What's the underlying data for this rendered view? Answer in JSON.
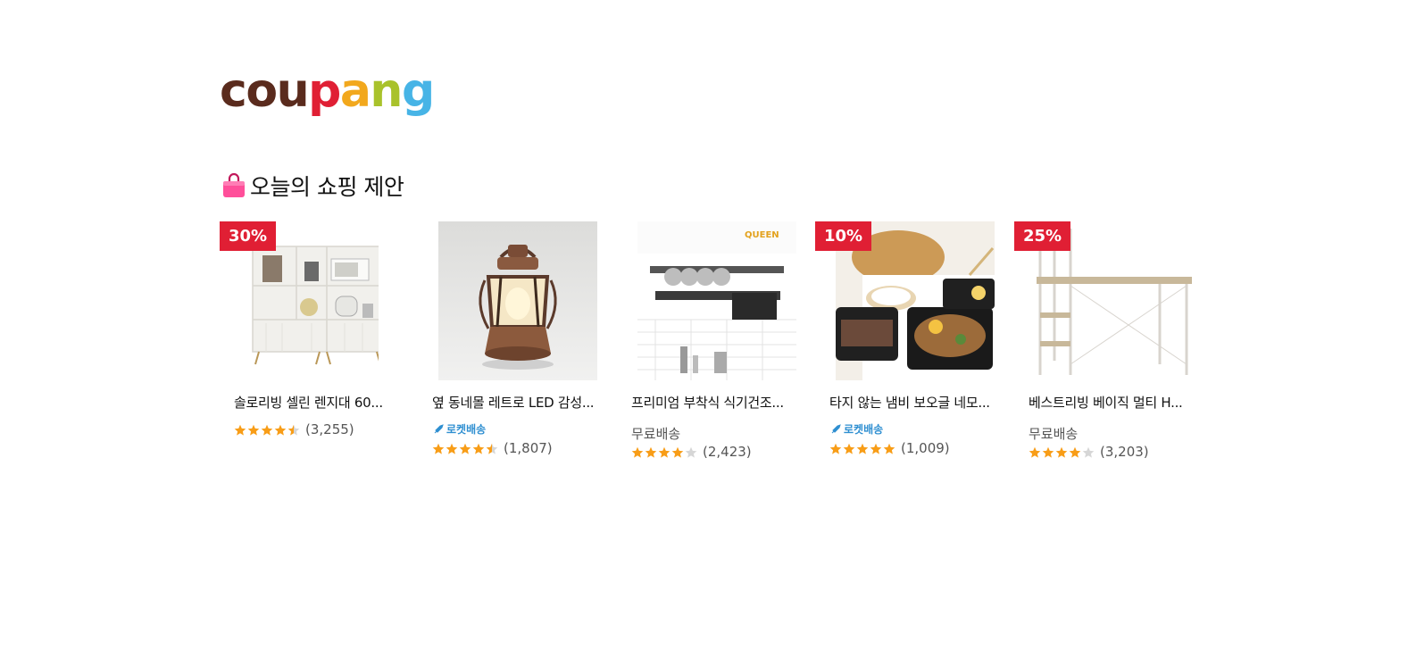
{
  "logo": {
    "letters": [
      {
        "char": "c",
        "color": "#5a2b1d"
      },
      {
        "char": "o",
        "color": "#5a2b1d"
      },
      {
        "char": "u",
        "color": "#5a2b1d"
      },
      {
        "char": "p",
        "color": "#e01f34"
      },
      {
        "char": "a",
        "color": "#f2a81d"
      },
      {
        "char": "n",
        "color": "#a9c22b"
      },
      {
        "char": "g",
        "color": "#47b4e6"
      }
    ]
  },
  "section": {
    "title": "오늘의 쇼핑 제안",
    "icon": "shopping-bag-icon"
  },
  "colors": {
    "badge": "#e01f34",
    "star": "#f89d17",
    "star_empty": "#d6d6d6",
    "rocket": "#2f8fd1"
  },
  "products": [
    {
      "badge": "30%",
      "image": "white-cabinet-with-appliances",
      "title": "솔로리빙 셀린 렌지대 60...",
      "delivery": "",
      "rating": 4.5,
      "review_count": "(3,255)"
    },
    {
      "badge": "",
      "image": "retro-copper-led-lantern",
      "title": "옆 동네몰 레트로 LED 감성...",
      "delivery": "로켓배송",
      "rating": 4.5,
      "review_count": "(1,807)"
    },
    {
      "badge": "",
      "image": "wall-mounted-dish-rack",
      "title": "프리미엄 부착식 식기건조...",
      "delivery": "무료배송",
      "rating": 4,
      "review_count": "(2,423)"
    },
    {
      "badge": "10%",
      "image": "square-grill-pans",
      "title": "타지 않는 냄비 보오글 네모...",
      "delivery": "로켓배송",
      "rating": 5,
      "review_count": "(1,009)"
    },
    {
      "badge": "25%",
      "image": "desk-with-shelves",
      "title": "베스트리빙 베이직 멀티 H...",
      "delivery": "무료배송",
      "rating": 4,
      "review_count": "(3,203)"
    }
  ]
}
